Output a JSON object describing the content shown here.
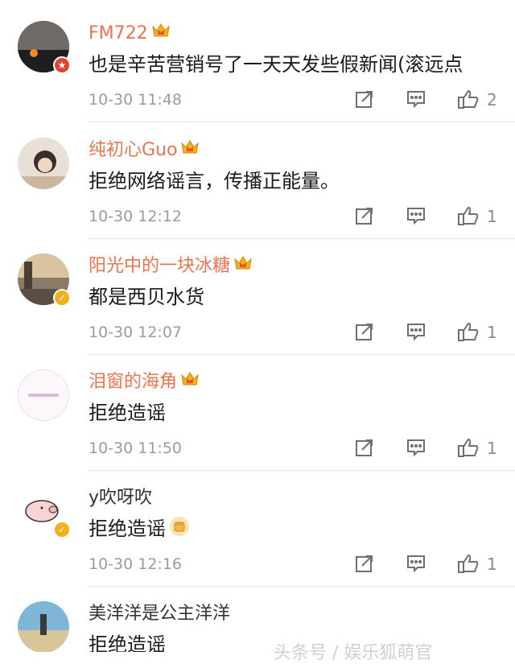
{
  "comments": [
    {
      "name": "FM722",
      "text": "也是辛苦营销号了一天天发些假新闻(滚远点",
      "time": "10-30 11:48",
      "likes": "2"
    },
    {
      "name": "纯初心Guo",
      "text": "拒绝网络谣言，传播正能量。",
      "time": "10-30 12:12",
      "likes": "1"
    },
    {
      "name": "阳光中的一块冰糖",
      "text": "都是西贝水货",
      "time": "10-30 12:07",
      "likes": "1"
    },
    {
      "name": "泪窗的海角",
      "text": "拒绝造谣",
      "time": "10-30 11:50",
      "likes": "1"
    },
    {
      "name": "y吹呀吹",
      "text": "拒绝造谣",
      "time": "10-30 12:16",
      "likes": "1"
    },
    {
      "name": "美洋洋是公主洋洋",
      "text": "拒绝造谣"
    }
  ],
  "watermark": "头条号 / 娱乐狐萌官",
  "colors": {
    "vip_name": "#eb7350",
    "timestamp": "#9b9b9b",
    "badge_red": "#e0452f",
    "badge_gold": "#f5b017"
  }
}
